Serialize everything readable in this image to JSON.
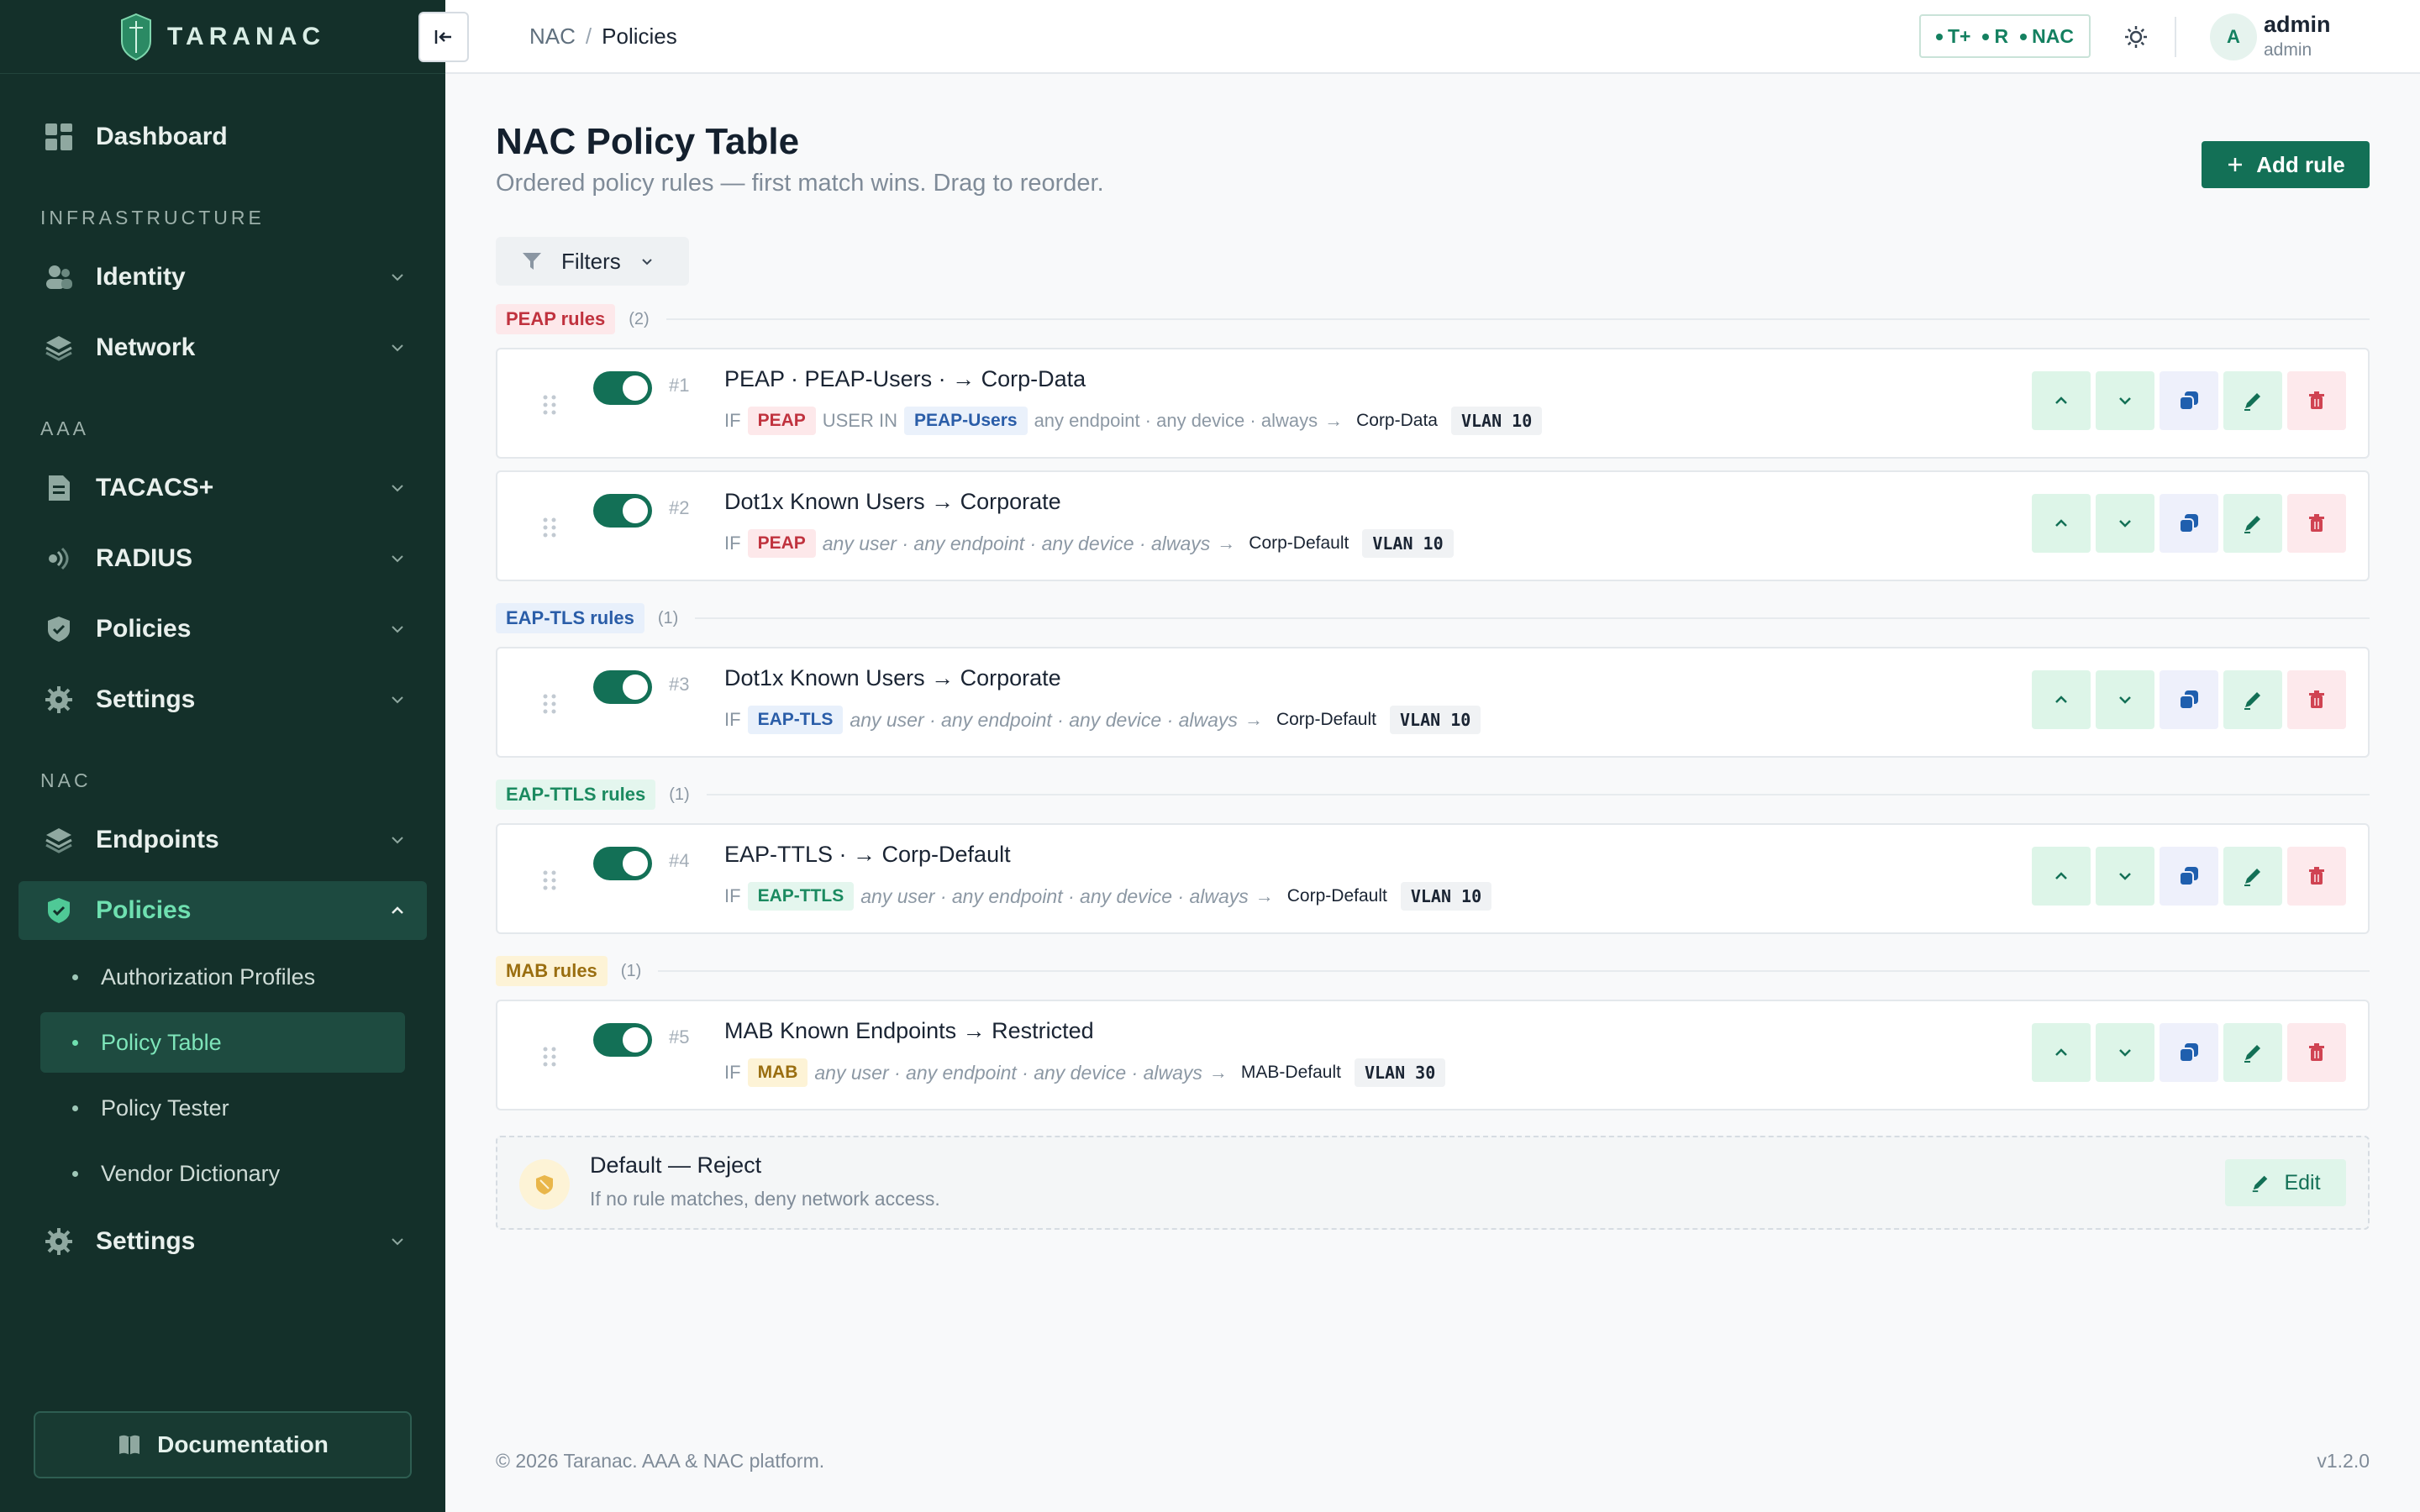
{
  "brand": {
    "name": "TARANAC"
  },
  "colors": {
    "sidebar_bg": "#14302a",
    "accent": "#137056",
    "accent_light": "#6fe0b0"
  },
  "sidebar": {
    "dashboard": "Dashboard",
    "sections": {
      "infrastructure": "INFRASTRUCTURE",
      "aaa": "AAA",
      "nac": "NAC"
    },
    "infra_items": [
      "Identity",
      "Network"
    ],
    "aaa_items": [
      "TACACS+",
      "RADIUS",
      "Policies",
      "Settings"
    ],
    "nac_items": {
      "endpoints": "Endpoints",
      "policies": "Policies",
      "settings": "Settings"
    },
    "policies_sub": [
      "Authorization Profiles",
      "Policy Table",
      "Policy Tester",
      "Vendor Dictionary"
    ],
    "documentation": "Documentation"
  },
  "topbar": {
    "crumbs": [
      "NAC",
      "Policies"
    ],
    "crumb_sep": "/",
    "protocols": [
      "T+",
      "R",
      "NAC"
    ],
    "avatar_letter": "A",
    "user_name": "admin",
    "user_role": "admin"
  },
  "page": {
    "title": "NAC Policy Table",
    "subtitle": "Ordered policy rules — first match wins. Drag to reorder.",
    "add_rule": "Add rule",
    "filters": "Filters"
  },
  "groups": [
    {
      "label": "PEAP rules",
      "count": "(2)"
    },
    {
      "label": "EAP-TLS rules",
      "count": "(1)"
    },
    {
      "label": "EAP-TTLS rules",
      "count": "(1)"
    },
    {
      "label": "MAB rules",
      "count": "(1)"
    }
  ],
  "rules": [
    {
      "num": "#1",
      "title": "PEAP · PEAP-Users · → Corp-Data",
      "if": "IF",
      "method": "PEAP",
      "user_in": "USER IN",
      "group": "PEAP-Users",
      "conditions": "any endpoint · any device · always",
      "arrow": "→",
      "profile": "Corp-Data",
      "vlan": "VLAN 10"
    },
    {
      "num": "#2",
      "title": "Dot1x Known Users → Corporate",
      "if": "IF",
      "method": "PEAP",
      "conditions": "any user · any endpoint · any device · always",
      "arrow": "→",
      "profile": "Corp-Default",
      "vlan": "VLAN 10"
    },
    {
      "num": "#3",
      "title": "Dot1x Known Users → Corporate",
      "if": "IF",
      "method": "EAP-TLS",
      "conditions": "any user · any endpoint · any device · always",
      "arrow": "→",
      "profile": "Corp-Default",
      "vlan": "VLAN 10"
    },
    {
      "num": "#4",
      "title": "EAP-TTLS · → Corp-Default",
      "if": "IF",
      "method": "EAP-TTLS",
      "conditions": "any user · any endpoint · any device · always",
      "arrow": "→",
      "profile": "Corp-Default",
      "vlan": "VLAN 10"
    },
    {
      "num": "#5",
      "title": "MAB Known Endpoints → Restricted",
      "if": "IF",
      "method": "MAB",
      "conditions": "any user · any endpoint · any device · always",
      "arrow": "→",
      "profile": "MAB-Default",
      "vlan": "VLAN 30"
    }
  ],
  "default_rule": {
    "title": "Default — Reject",
    "subtitle": "If no rule matches, deny network access.",
    "edit": "Edit"
  },
  "footer": {
    "copyright": "© 2026 Taranac. AAA & NAC platform.",
    "version": "v1.2.0"
  }
}
